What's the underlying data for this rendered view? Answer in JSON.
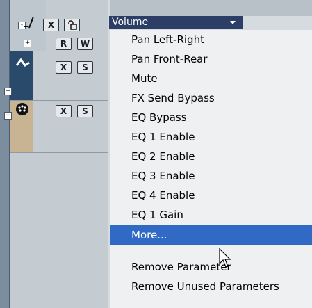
{
  "param_select": {
    "value": "Volume"
  },
  "tracks": [
    {
      "buttons": [
        "X",
        "R",
        "W"
      ]
    },
    {
      "buttons": [
        "X",
        "S"
      ]
    },
    {
      "buttons": [
        "X",
        "S"
      ]
    }
  ],
  "menu": {
    "items": [
      "Pan Left-Right",
      "Pan Front-Rear",
      "Mute",
      "FX Send Bypass",
      "EQ Bypass",
      "EQ 1 Enable",
      "EQ 2 Enable",
      "EQ 3 Enable",
      "EQ 4 Enable",
      "EQ 1 Gain",
      "More..."
    ],
    "items_after_sep": [
      "Remove Parameter",
      "Remove Unused Parameters"
    ],
    "selected": "More..."
  },
  "plus_glyph": "+",
  "minus_glyph": "-",
  "colors": {
    "select_bg": "#2c3e66",
    "highlight": "#316ac5",
    "menu_bg": "#eef0f2"
  }
}
